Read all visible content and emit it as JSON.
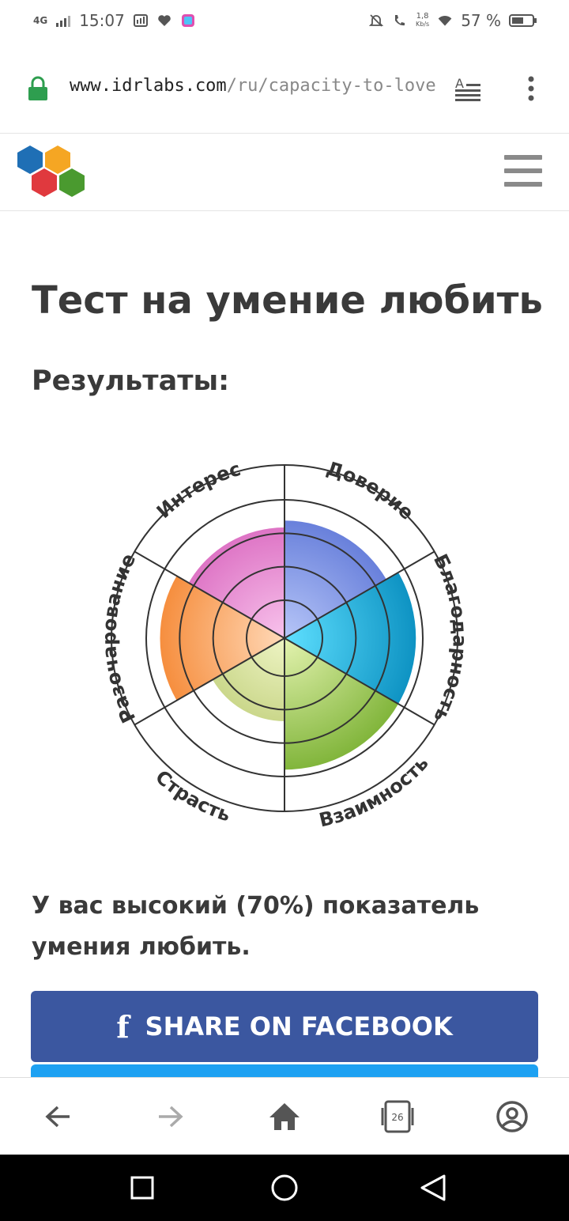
{
  "status_bar": {
    "network": "4G",
    "time": "15:07",
    "speed": "1,8",
    "speed_unit": "Kb/s",
    "battery": "57 %"
  },
  "browser": {
    "url_domain": "www.idrlabs.com",
    "url_path": "/ru/capacity-to-love/t",
    "tab_count": "26"
  },
  "page": {
    "title": "Тест на умение любить",
    "results_heading": "Результаты:",
    "result_text": "У вас высокий (70%) показатель умения любить.",
    "share_facebook_label": "SHARE ON FACEBOOK"
  },
  "chart_data": {
    "type": "radial-bar",
    "title": "",
    "scale": "5 concentric rings",
    "categories": [
      "Доверие",
      "Благодарность",
      "Взаимность",
      "Страсть",
      "Разочарование",
      "Интерес"
    ],
    "values": [
      0.85,
      0.95,
      0.95,
      0.6,
      0.9,
      0.8
    ],
    "colors": [
      "#5b74d6",
      "#1aa9d8",
      "#8dbd3a",
      "#b8c96a",
      "#f28a3a",
      "#dd70c0"
    ]
  },
  "colors": {
    "facebook": "#3b57a0",
    "twitter": "#1da1f2",
    "lock": "#2e9e4f"
  }
}
